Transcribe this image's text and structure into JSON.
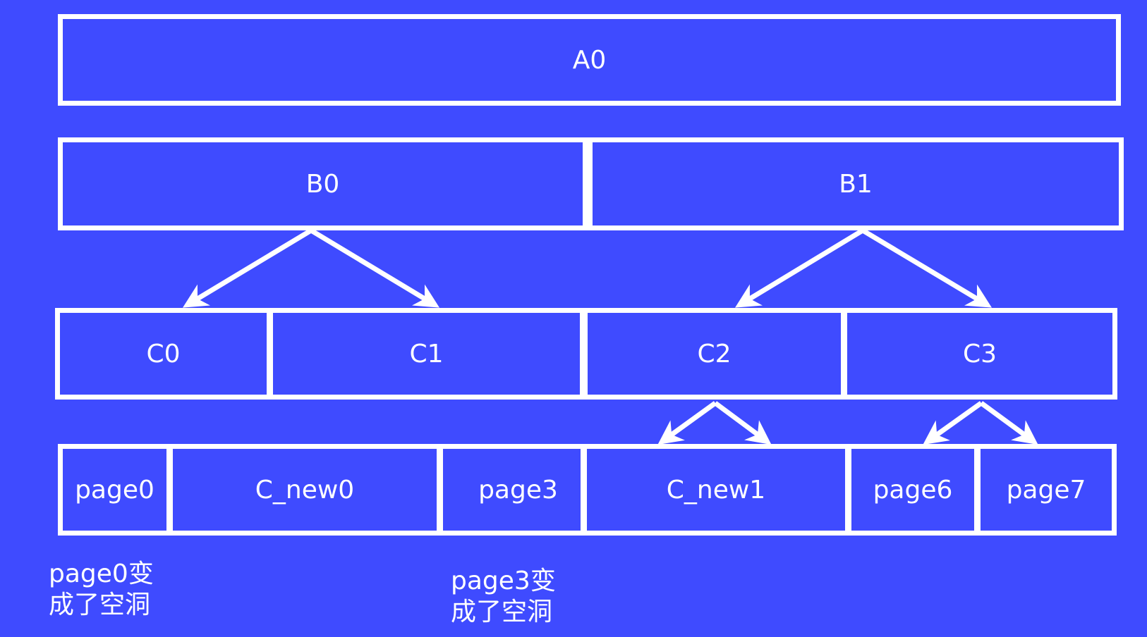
{
  "diagram": {
    "level_a": [
      {
        "id": "A0",
        "label": "A0"
      }
    ],
    "level_b": [
      {
        "id": "B0",
        "label": "B0"
      },
      {
        "id": "B1",
        "label": "B1"
      }
    ],
    "level_c": [
      {
        "id": "C0",
        "label": "C0"
      },
      {
        "id": "C1",
        "label": "C1"
      },
      {
        "id": "C2",
        "label": "C2"
      },
      {
        "id": "C3",
        "label": "C3"
      }
    ],
    "level_d": [
      {
        "id": "page0",
        "label": "page0"
      },
      {
        "id": "c_new0",
        "label": "C_new0"
      },
      {
        "id": "page3",
        "label": "page3"
      },
      {
        "id": "c_new1",
        "label": "C_new1"
      },
      {
        "id": "page6",
        "label": "page6"
      },
      {
        "id": "page7",
        "label": "page7"
      }
    ],
    "edges": [
      {
        "from": "B0",
        "to": "C0"
      },
      {
        "from": "B0",
        "to": "C1"
      },
      {
        "from": "B1",
        "to": "C2"
      },
      {
        "from": "B1",
        "to": "C3"
      },
      {
        "from": "C2",
        "to": "c_new1-left"
      },
      {
        "from": "C2",
        "to": "c_new1-right"
      },
      {
        "from": "C3",
        "to": "page6"
      },
      {
        "from": "C3",
        "to": "page7"
      }
    ],
    "captions": [
      {
        "target": "page0",
        "text": "page0变\n成了空洞"
      },
      {
        "target": "page3",
        "text": "page3变\n成了空洞"
      }
    ],
    "colors": {
      "background": "#3f4bff",
      "stroke": "#ffffff"
    }
  }
}
